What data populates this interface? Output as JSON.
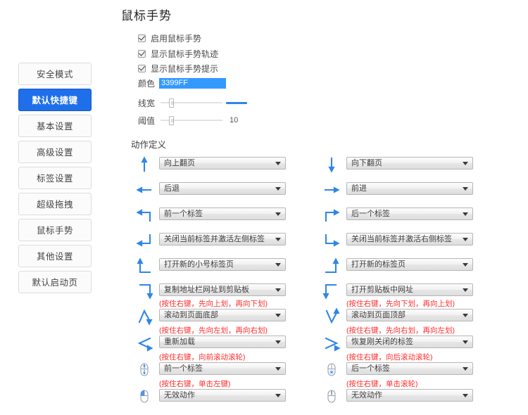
{
  "page": {
    "title": "鼠标手势",
    "actions_heading": "动作定义"
  },
  "sidebar": {
    "items": [
      {
        "label": "安全模式",
        "active": false
      },
      {
        "label": "默认快捷键",
        "active": true
      },
      {
        "label": "基本设置",
        "active": false
      },
      {
        "label": "高级设置",
        "active": false
      },
      {
        "label": "标签设置",
        "active": false
      },
      {
        "label": "超级拖拽",
        "active": false
      },
      {
        "label": "鼠标手势",
        "active": false
      },
      {
        "label": "其他设置",
        "active": false
      },
      {
        "label": "默认启动页",
        "active": false
      }
    ]
  },
  "options": {
    "checkboxes": [
      {
        "label": "启用鼠标手势",
        "checked": true
      },
      {
        "label": "显示鼠标手势轨迹",
        "checked": true
      },
      {
        "label": "显示鼠标手势提示",
        "checked": true
      }
    ],
    "color": {
      "label": "颜色",
      "value": "3399FF",
      "swatch": "#3399FF"
    },
    "line_width": {
      "label": "线宽",
      "knob_percent": 14,
      "preview_color": "#2F86E8"
    },
    "threshold": {
      "label": "阈值",
      "knob_percent": 14,
      "value": "10"
    }
  },
  "gestures": {
    "left_column": [
      {
        "icon": "arrow-up",
        "hint": "",
        "value": "向上翻页"
      },
      {
        "icon": "arrow-left",
        "hint": "",
        "value": "后退"
      },
      {
        "icon": "arrow-up-left-turn",
        "hint": "",
        "value": "前一个标签"
      },
      {
        "icon": "arrow-down-left-turn",
        "hint": "",
        "value": "关闭当前标签并激活左侧标签"
      },
      {
        "icon": "arrow-up-right-base",
        "hint": "",
        "value": "打开新的小号标签页"
      },
      {
        "icon": "arrow-down-left-base",
        "hint": "",
        "value": "复制地址栏网址到剪贴板"
      },
      {
        "icon": "up-down-v",
        "hint": "(按住右键，先向上划，再向下划)",
        "value": "滚动到页面底部"
      },
      {
        "icon": "left-arrow-angle",
        "hint": "(按住右键，先向左划，再向右划)",
        "value": "重新加载"
      },
      {
        "icon": "mouse-wheel-updown",
        "hint": "(按住右键，向前滚动滚轮)",
        "value": "前一个标签"
      },
      {
        "icon": "mouse-left-click",
        "hint": "(按住右键，单击左键)",
        "value": "无效动作"
      }
    ],
    "right_column": [
      {
        "icon": "arrow-down",
        "hint": "",
        "value": "向下翻页"
      },
      {
        "icon": "arrow-right",
        "hint": "",
        "value": "前进"
      },
      {
        "icon": "arrow-up-right-turn",
        "hint": "",
        "value": "后一个标签"
      },
      {
        "icon": "arrow-down-right-turn",
        "hint": "",
        "value": "关闭当前标签并激活右侧标签"
      },
      {
        "icon": "arrow-up-left-base",
        "hint": "",
        "value": "打开新的标签页"
      },
      {
        "icon": "arrow-down-right-base",
        "hint": "",
        "value": "打开剪贴板中网址"
      },
      {
        "icon": "down-up-v",
        "hint": "(按住右键，先向下划，再向上划)",
        "value": "滚动到页面顶部"
      },
      {
        "icon": "right-arrow-angle",
        "hint": "(按住右键，先向右划，再向左划)",
        "value": "恢复刚关闭的标签"
      },
      {
        "icon": "mouse-wheel-down",
        "hint": "(按住右键，向后滚动滚轮)",
        "value": "后一个标签"
      },
      {
        "icon": "mouse-wheel-click",
        "hint": "(按住右键，单击滚轮)",
        "value": "无效动作"
      }
    ]
  },
  "colors": {
    "accent": "#1F6FEB",
    "gesture_blue": "#2F86E8",
    "hint_red": "#FF2D2D"
  }
}
